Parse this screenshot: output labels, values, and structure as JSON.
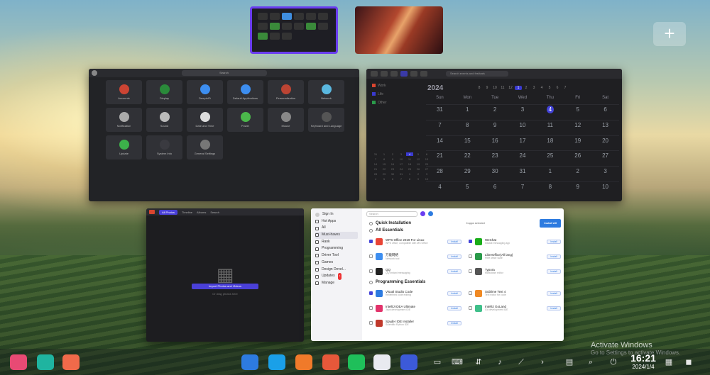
{
  "desktop": {
    "add_workspace": "+",
    "activation": {
      "title": "Activate Windows",
      "subtitle": "Go to Settings to activate Windows."
    }
  },
  "control_center": {
    "search_placeholder": "Search",
    "tiles": [
      "Accounts",
      "Display",
      "DeepinID",
      "Default Applications",
      "Personalization",
      "Network",
      "Notification",
      "Sound",
      "Date and Time",
      "Power",
      "Mouse",
      "Keyboard and Language",
      "Update",
      "System Info",
      "General Settings"
    ]
  },
  "calendar": {
    "search_placeholder": "Search events and festivals",
    "year": "2024",
    "months": [
      "8",
      "9",
      "10",
      "11",
      "12",
      "1",
      "2",
      "3",
      "4",
      "5",
      "6",
      "7"
    ],
    "selected_month": "1",
    "side": [
      "Work",
      "Life",
      "Other"
    ],
    "weekdays": [
      "Sun",
      "Mon",
      "Tue",
      "Wed",
      "Thu",
      "Fri",
      "Sat"
    ],
    "weeks": [
      [
        "31",
        "1",
        "2",
        "3",
        "4",
        "5",
        "6"
      ],
      [
        "7",
        "8",
        "9",
        "10",
        "11",
        "12",
        "13"
      ],
      [
        "14",
        "15",
        "16",
        "17",
        "18",
        "19",
        "20"
      ],
      [
        "21",
        "22",
        "23",
        "24",
        "25",
        "26",
        "27"
      ],
      [
        "28",
        "29",
        "30",
        "31",
        "1",
        "2",
        "3"
      ],
      [
        "4",
        "5",
        "6",
        "7",
        "8",
        "9",
        "10"
      ]
    ]
  },
  "album": {
    "tabs": [
      "All Photos",
      "Timeline",
      "Albums",
      "Search"
    ],
    "import_button": "Import Photos and Videos",
    "hint": "Or drag photos here"
  },
  "store": {
    "sign_in": "Sign In",
    "search_placeholder": "Search",
    "nav": [
      "Hot Apps",
      "All",
      "Must-haves",
      "Rank",
      "Programming",
      "Driver Tool",
      "Games",
      "Design Devel...",
      "Updates",
      "Manage"
    ],
    "updates_badge": "1",
    "quick_install": "Quick Installation",
    "suggested": "3 apps selected",
    "install_all": "Install All",
    "sections": [
      {
        "title": "All Essentials",
        "apps": [
          {
            "name": "WPS Office 2019 For Linux",
            "desc": "WPS office, compatible with MS Office",
            "btn": "Install",
            "checked": true,
            "color": "#e84436"
          },
          {
            "name": "WeChat",
            "desc": "Instant messaging app",
            "btn": "Install",
            "checked": true,
            "color": "#1aad19"
          },
          {
            "name": "万能网络",
            "desc": "Network tool",
            "btn": "Install",
            "checked": false,
            "color": "#3d8ef0"
          },
          {
            "name": "LibreOffice(All lang)",
            "desc": "Free office suite",
            "btn": "Install",
            "checked": false,
            "color": "#2a9a4a"
          },
          {
            "name": "QQ",
            "desc": "QQ instant messaging",
            "btn": "Install",
            "checked": false,
            "color": "#222222"
          },
          {
            "name": "Typora",
            "desc": "Markdown editor",
            "btn": "Install",
            "checked": false,
            "color": "#555555"
          }
        ]
      },
      {
        "title": "Programming Essentials",
        "apps": [
          {
            "name": "Visual Studio Code",
            "desc": "Redefined code editing",
            "btn": "Install",
            "checked": true,
            "color": "#2d7be0"
          },
          {
            "name": "Sublime Text 4",
            "desc": "Text editor for code",
            "btn": "Install",
            "checked": false,
            "color": "#f08a24"
          },
          {
            "name": "IntelliJ IDEA Ultimate",
            "desc": "Java development IDE",
            "btn": "Install",
            "checked": false,
            "color": "#e2336b"
          },
          {
            "name": "IntelliJ GoLand",
            "desc": "Go development IDE",
            "btn": "Install",
            "checked": false,
            "color": "#3fbf8a"
          },
          {
            "name": "Spyder IDE Installer",
            "desc": "Scientific Python IDE",
            "btn": "Install",
            "checked": false,
            "color": "#c0392b"
          }
        ]
      }
    ]
  },
  "taskbar": {
    "time": "16:21",
    "date": "2024/1/4",
    "apps": [
      {
        "name": "launcher-icon",
        "color": "#e84a74"
      },
      {
        "name": "multitask-view-icon",
        "color": "#1fb4a0"
      },
      {
        "name": "workspace-icon",
        "color": "#f06a4a"
      },
      {
        "name": "file-manager-icon",
        "color": "#2d7be0"
      },
      {
        "name": "browser-icon",
        "color": "#1aa0e8"
      },
      {
        "name": "app-store-icon",
        "color": "#f07a2a"
      },
      {
        "name": "album-icon",
        "color": "#e6583a"
      },
      {
        "name": "music-icon",
        "color": "#1fbf5a"
      },
      {
        "name": "calendar-icon",
        "color": "#e8eaf0"
      },
      {
        "name": "settings-icon",
        "color": "#3c5ad8"
      }
    ],
    "tray": [
      "desktop-icon",
      "keyboard-icon",
      "usb-icon",
      "volume-icon",
      "network-icon",
      "expand-icon",
      "input-method-icon",
      "search-icon",
      "power-icon"
    ]
  }
}
